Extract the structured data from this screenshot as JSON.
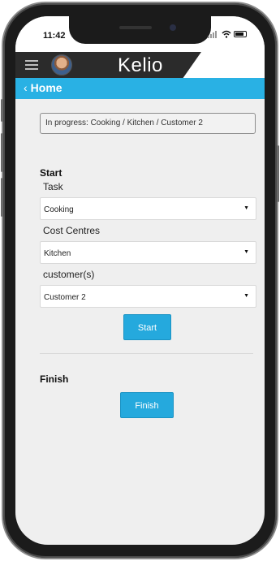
{
  "status_bar": {
    "time": "11:42"
  },
  "app_bar": {
    "logo": "Kelio"
  },
  "subheader": {
    "chevron": "‹",
    "title": "Home"
  },
  "in_progress": {
    "text": "In progress: Cooking / Kitchen / Customer 2"
  },
  "start_section": {
    "title": "Start",
    "task_label": "Task",
    "task_value": "Cooking",
    "cost_centre_label": "Cost Centres",
    "cost_centre_value": "Kitchen",
    "customer_label": "customer(s)",
    "customer_value": "Customer 2",
    "button_label": "Start"
  },
  "finish_section": {
    "title": "Finish",
    "button_label": "Finish"
  },
  "colors": {
    "accent": "#29b1e4",
    "button": "#25a9dd",
    "app_bar": "#2b2b2b"
  },
  "icons": {
    "menu": "hamburger-menu-icon",
    "dropdown": "dropdown-arrow-icon"
  }
}
